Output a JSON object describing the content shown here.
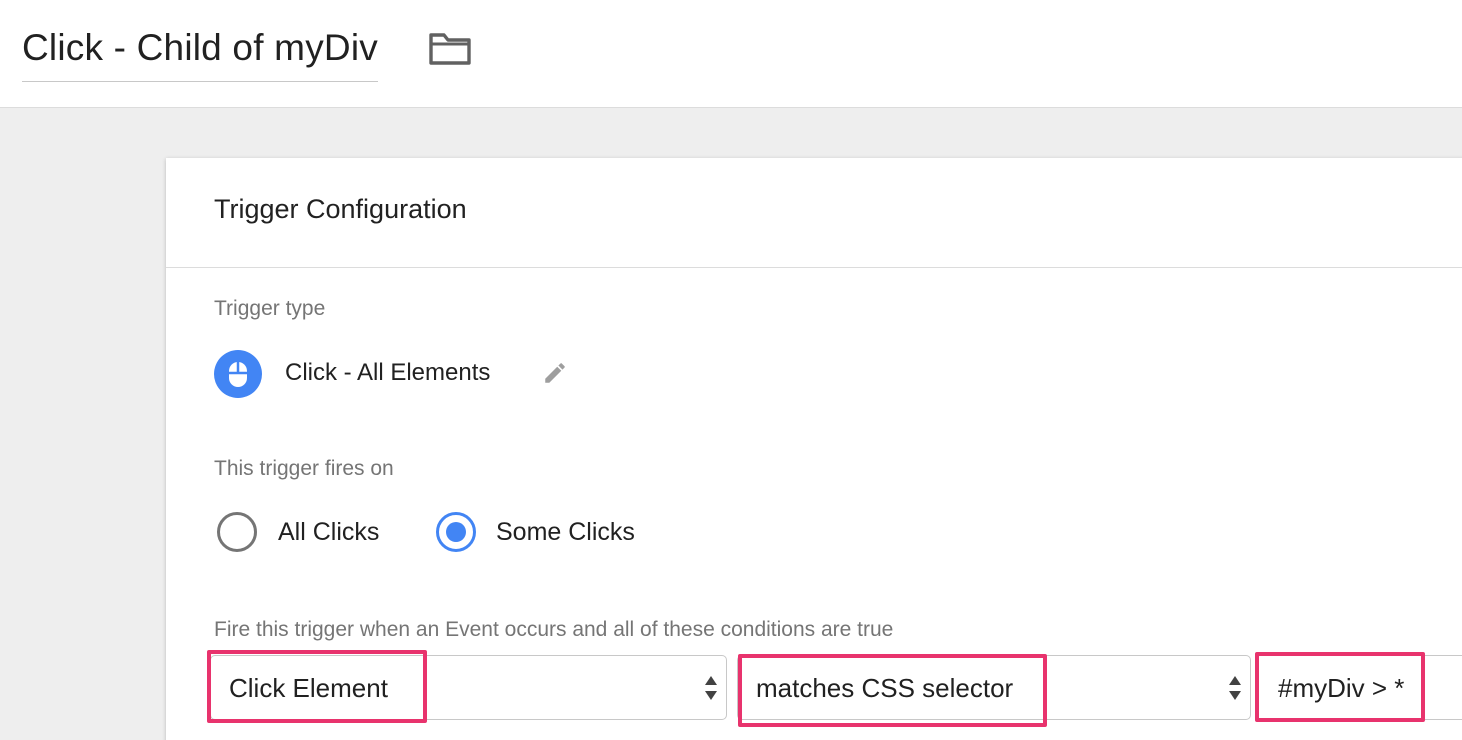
{
  "header": {
    "title": "Click - Child of myDiv",
    "folder_icon": "folder-icon"
  },
  "card": {
    "title": "Trigger Configuration",
    "trigger_type": {
      "label": "Trigger type",
      "name": "Click - All Elements",
      "icon": "mouse-icon",
      "edit_icon": "pencil-icon",
      "icon_color": "#4285f4"
    },
    "fires_on": {
      "label": "This trigger fires on",
      "options": [
        {
          "label": "All Clicks",
          "selected": false
        },
        {
          "label": "Some Clicks",
          "selected": true
        }
      ]
    },
    "conditions": {
      "label": "Fire this trigger when an Event occurs and all of these conditions are true",
      "variable": "Click Element",
      "operator": "matches CSS selector",
      "value": "#myDiv > *"
    }
  },
  "colors": {
    "accent": "#4285f4",
    "highlight": "#e8336d",
    "background": "#eeeeee"
  }
}
